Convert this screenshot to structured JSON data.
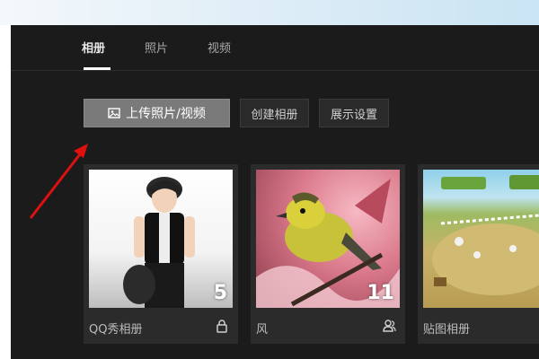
{
  "tabs": [
    {
      "label": "相册",
      "active": true
    },
    {
      "label": "照片",
      "active": false
    },
    {
      "label": "视频",
      "active": false
    }
  ],
  "toolbar": {
    "upload_label": "上传照片/视频",
    "create_label": "创建相册",
    "display_label": "展示设置"
  },
  "albums": [
    {
      "name": "QQ秀相册",
      "count": "5",
      "icon": "lock-icon"
    },
    {
      "name": "风",
      "count": "11",
      "icon": "friends-icon"
    },
    {
      "name": "贴图相册",
      "count": "",
      "icon": ""
    }
  ],
  "colors": {
    "window_bg": "#1b1b1b",
    "card_bg": "#2b2b2b",
    "primary_button": "#7a7a7a",
    "annotation_arrow": "#e01010"
  }
}
